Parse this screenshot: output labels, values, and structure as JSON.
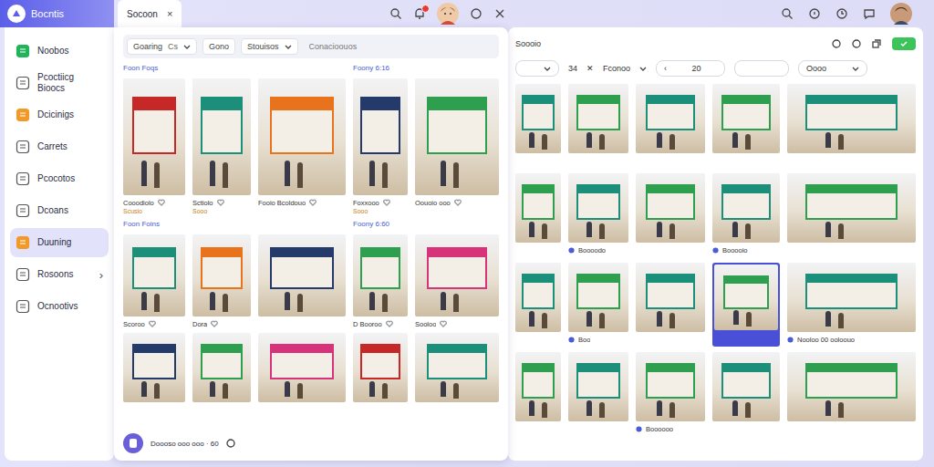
{
  "sidebar": {
    "title": "Bocntis",
    "items": [
      {
        "label": "Noobos",
        "selected": false
      },
      {
        "label": "Pcoctiicg Bioocs",
        "selected": false
      },
      {
        "label": "Dcicinigs",
        "selected": false
      },
      {
        "label": "Carrets",
        "selected": false
      },
      {
        "label": "Pcocotos",
        "selected": false
      },
      {
        "label": "Dcoans",
        "selected": false
      },
      {
        "label": "Duuning",
        "selected": true
      },
      {
        "label": "Rosoons",
        "selected": false,
        "chevron": "›"
      },
      {
        "label": "Ocnootivs",
        "selected": false
      }
    ]
  },
  "topbar": {
    "tab": {
      "label": "Socoon",
      "close": "×"
    },
    "has_notification": true
  },
  "search_panel": {
    "filters": {
      "group_label": "Goaring",
      "group_value": "Cs",
      "chip": "Gono",
      "dropdown": "Stouisos",
      "placeholder": "Conacioouos"
    },
    "sections": [
      {
        "title": "Foon Foqs",
        "meta": "Foony 6:16",
        "rows": [
          [
            {
              "caption": "Cooodiolo",
              "sub": "Scusio"
            },
            {
              "caption": "Sctiolo",
              "sub": "Sooo"
            },
            {
              "caption": "Fooio Bcoldouo"
            },
            {
              "caption": "Foxxooo",
              "sub": "Sooo"
            },
            {
              "caption": "Oouoio ooo"
            }
          ]
        ]
      },
      {
        "title": "Foon Foins",
        "meta": "Foony 6:60",
        "rows": [
          [
            {
              "caption": "Scoroo"
            },
            {
              "caption": "Dora"
            },
            {},
            {
              "caption": "D Booroo"
            },
            {
              "caption": "Sooloo"
            }
          ],
          [
            {},
            {},
            {},
            {},
            {}
          ]
        ]
      }
    ],
    "footer": {
      "text": "Doooso ooo ooo · 60"
    }
  },
  "gallery": {
    "title": "Soooio",
    "toolbar": {
      "count": "34",
      "close": "✕",
      "label": "Fconoo",
      "prev": "‹",
      "page": "20",
      "sort": "Oooo"
    },
    "tiles": [
      {
        "selected": false
      },
      {
        "selected": false
      },
      {
        "selected": false
      },
      {
        "selected": false
      },
      {
        "selected": false
      },
      {
        "selected": false
      },
      {
        "selected": false,
        "caption": "Boooodo"
      },
      {
        "selected": false
      },
      {
        "selected": false,
        "caption": "Booooio"
      },
      {
        "selected": false
      },
      {
        "selected": false
      },
      {
        "selected": false,
        "caption": "Boo"
      },
      {
        "selected": false
      },
      {
        "selected": true
      },
      {
        "selected": false,
        "caption": "Nooloo 00 ooloouo"
      },
      {
        "selected": false
      },
      {
        "selected": false
      },
      {
        "selected": false,
        "caption": "Boooooo"
      },
      {
        "selected": false
      },
      {
        "selected": false
      }
    ]
  }
}
